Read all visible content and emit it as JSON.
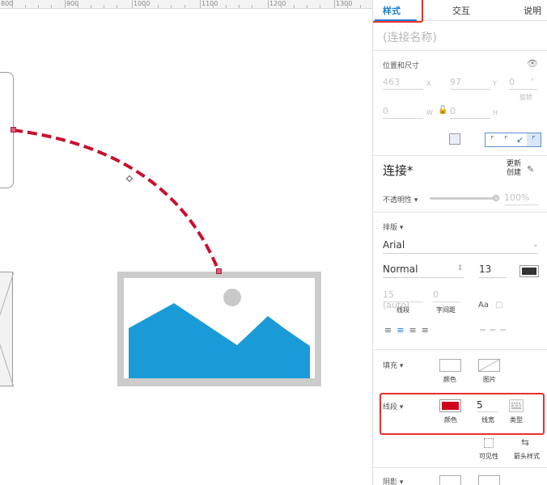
{
  "ruler": {
    "labels": [
      "800",
      "900",
      "1000",
      "1100",
      "1200",
      "1300"
    ]
  },
  "panel": {
    "tabs": [
      "样式",
      "交互",
      "说明"
    ],
    "name_placeholder": "(连接名称)",
    "position": {
      "title": "位置和尺寸",
      "x": "463",
      "x_unit": "X",
      "y": "97",
      "y_unit": "Y",
      "rotation": "0",
      "rotation_unit": "°",
      "rotation_caption": "旋转",
      "w": "0",
      "w_unit": "W",
      "h": "0",
      "h_unit": "H"
    },
    "style": {
      "name": "连接*",
      "update_line1": "更新",
      "update_line2": "创建",
      "opacity_label": "不透明性",
      "opacity_value": "100%"
    },
    "typography": {
      "title": "排版",
      "font": "Arial",
      "weight": "Normal",
      "size": "13",
      "text_color": "#333333",
      "line_spacing": "15 (auto)",
      "line_spacing_caption": "线段",
      "char_spacing": "0",
      "char_spacing_caption": "字间距"
    },
    "fill": {
      "title": "填充",
      "color_caption": "颜色",
      "image_caption": "图片"
    },
    "line": {
      "title": "线段",
      "color": "#d0021b",
      "color_caption": "颜色",
      "width": "5",
      "width_caption": "线宽",
      "type_caption": "类型",
      "visibility_caption": "可见性",
      "arrow_caption": "箭头样式"
    },
    "shadow": {
      "title": "阴影"
    }
  },
  "colors": {
    "accent": "#1a7ed1",
    "highlight": "#ea3030",
    "connector": "#c8102e",
    "image_blue": "#1a9bd7"
  }
}
